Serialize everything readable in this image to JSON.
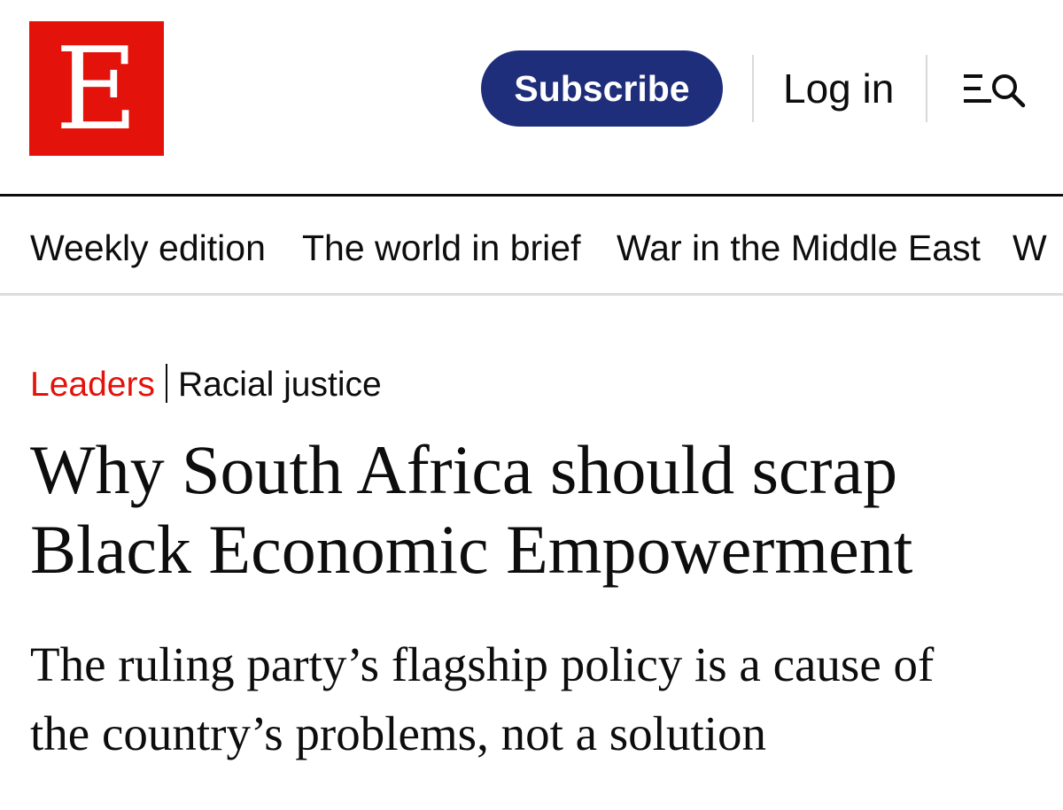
{
  "brand": {
    "logo_letter": "E",
    "color": "#e3120b"
  },
  "header": {
    "subscribe_label": "Subscribe",
    "subscribe_color": "#1f2e7a",
    "login_label": "Log in",
    "menu_icon": "menu-search-icon"
  },
  "nav": {
    "items": [
      {
        "label": "Weekly edition"
      },
      {
        "label": "The world in brief"
      },
      {
        "label": "War in the Middle East"
      },
      {
        "label": "W"
      }
    ]
  },
  "article": {
    "section": "Leaders",
    "topic": "Racial justice",
    "headline_line1": "Why South Africa should scrap",
    "headline_line2": "Black Economic Empowerment",
    "subhead_line1": "The ruling party’s flagship policy is a cause of",
    "subhead_line2": "the country’s problems, not a solution"
  }
}
